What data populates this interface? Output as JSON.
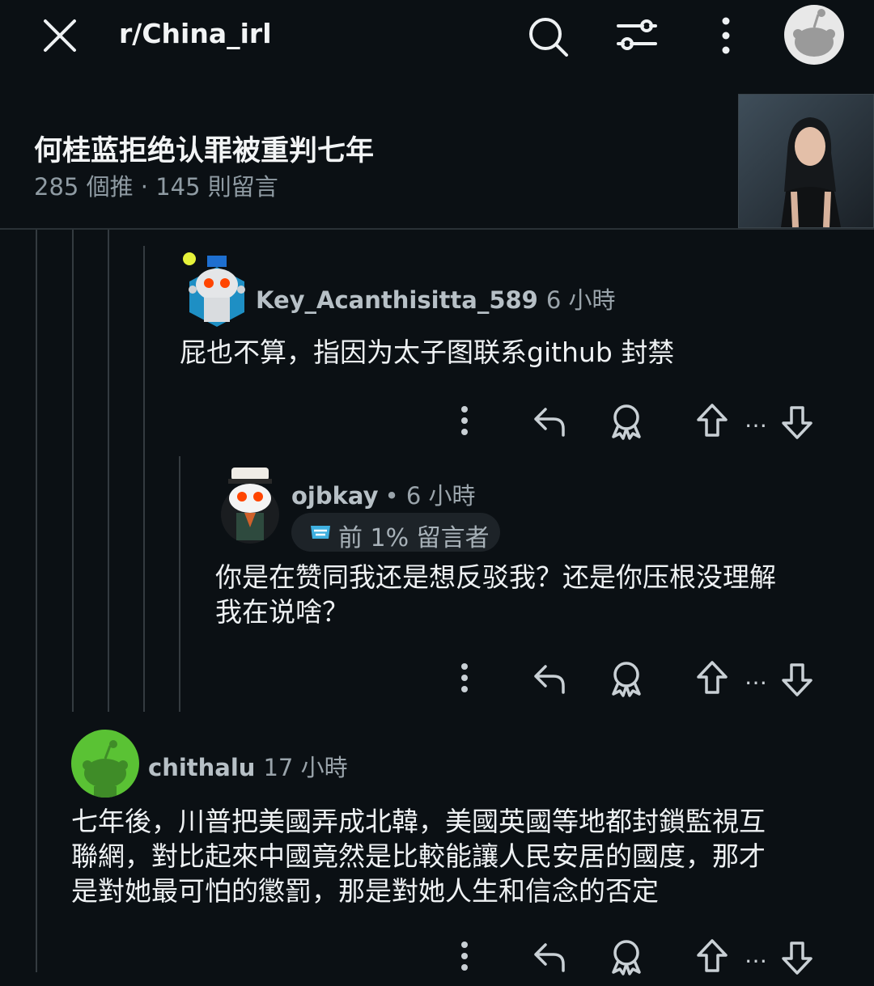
{
  "header": {
    "subreddit": "r/China_irl"
  },
  "post": {
    "title": "何桂蓝拒绝认罪被重判七年",
    "meta": "285 個推 · 145 則留言"
  },
  "comments": [
    {
      "username": "Key_Acanthisitta_589",
      "time": "6 小時",
      "body": "屁也不算，指因为太子图联系github 封禁"
    },
    {
      "username": "ojbkay",
      "time": "• 6 小時",
      "badge": "前 1% 留言者",
      "body_line1": "你是在赞同我还是想反驳我？还是你压根没理解",
      "body_line2": "我在说啥？"
    },
    {
      "username": "chithalu",
      "time": "17 小時",
      "body_line1": "七年後，川普把美國弄成北韓，美國英國等地都封鎖監視互",
      "body_line2": "聯網，對比起來中國竟然是比較能讓人民安居的國度，那才",
      "body_line3": "是對她最可怕的懲罰，那是對她人生和信念的否定"
    }
  ],
  "action_more": "…",
  "icons": [
    "close-icon",
    "search-icon",
    "filter-icon",
    "more-vertical-icon",
    "reply-icon",
    "award-icon",
    "upvote-icon",
    "downvote-icon"
  ]
}
